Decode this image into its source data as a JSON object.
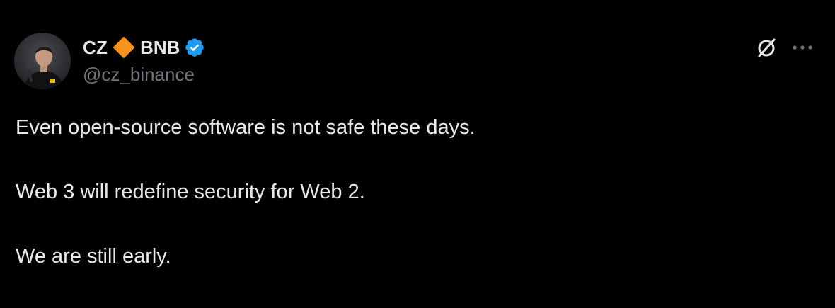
{
  "author": {
    "display_name": "CZ",
    "display_name_suffix": "BNB",
    "handle": "@cz_binance",
    "name_badge_icon": "orange-diamond-icon",
    "verified_icon": "verified-badge-icon"
  },
  "actions": {
    "grok_icon": "grok-icon",
    "more_icon": "more-options-icon"
  },
  "tweet": {
    "lines": [
      "Even open-source software is not safe these days.",
      "Web 3 will redefine security for Web 2.",
      "We are still early."
    ]
  },
  "colors": {
    "background": "#000000",
    "text_primary": "#e7e9ea",
    "text_secondary": "#71767b",
    "verified_blue": "#1d9bf0",
    "diamond_orange": "#f7931a"
  }
}
